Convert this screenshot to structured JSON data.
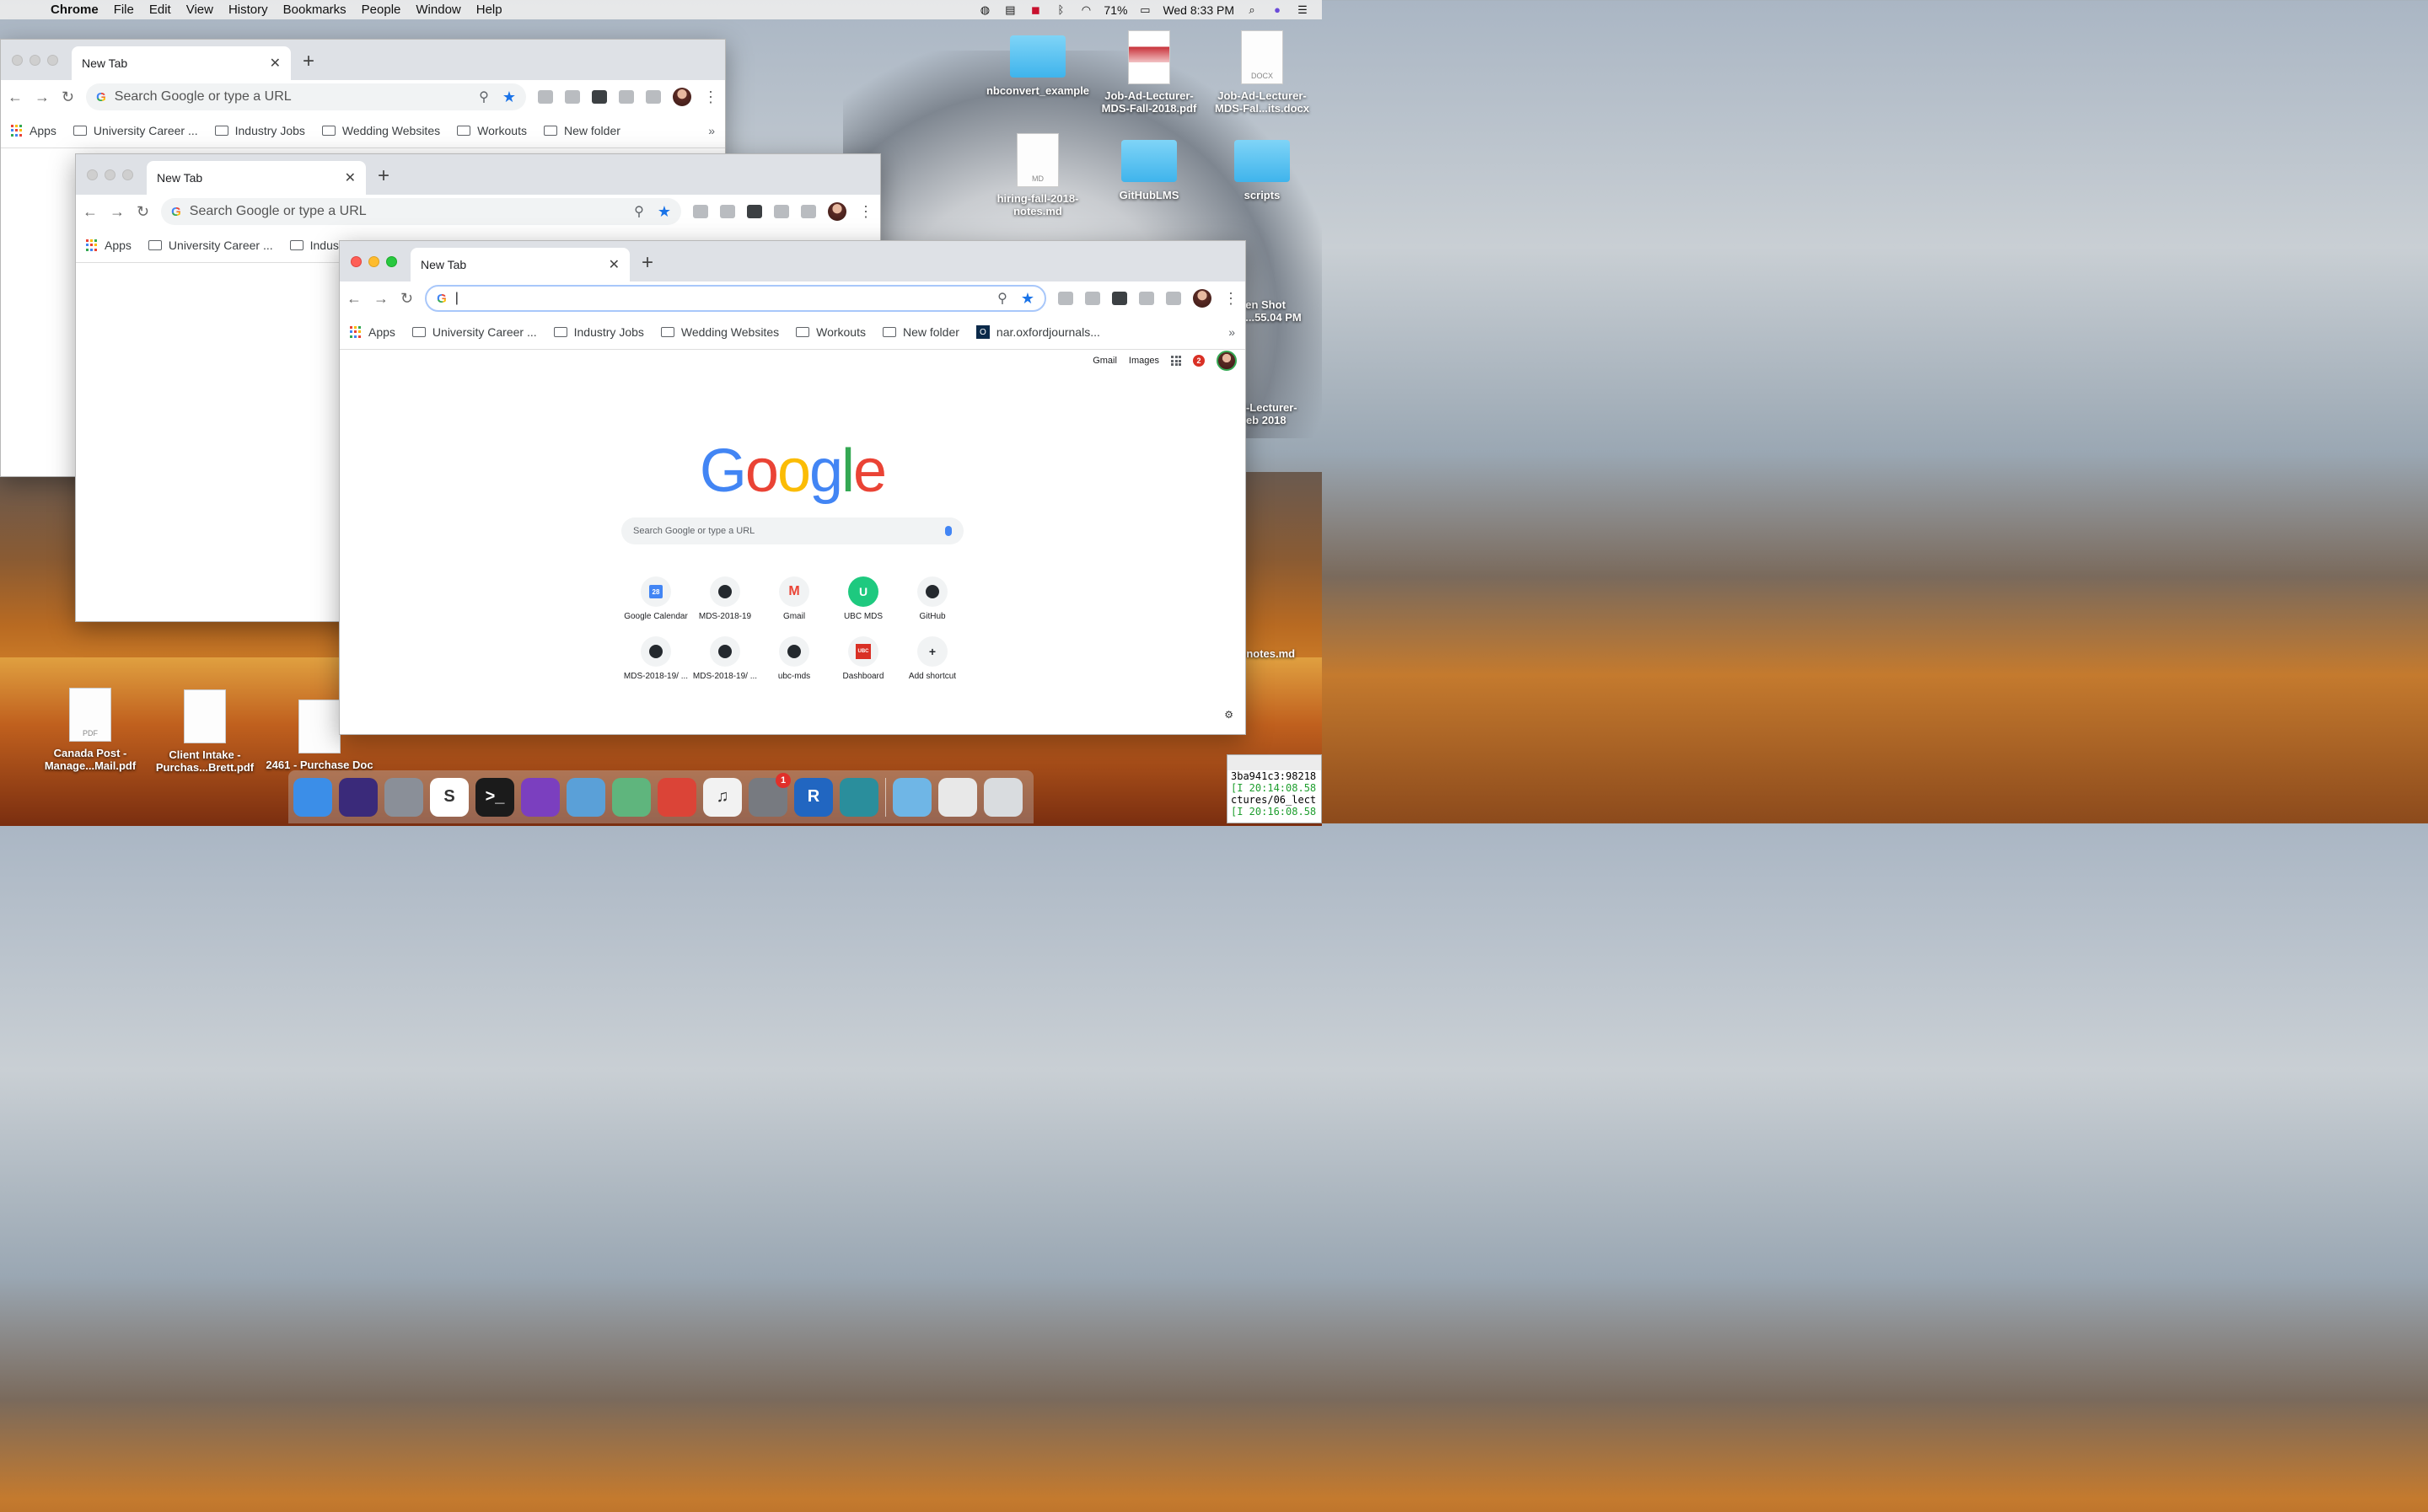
{
  "menubar": {
    "app": "Chrome",
    "items": [
      "File",
      "Edit",
      "View",
      "History",
      "Bookmarks",
      "People",
      "Window",
      "Help"
    ],
    "battery": "71%",
    "clock": "Wed 8:33 PM"
  },
  "browser": {
    "tab_title": "New Tab",
    "omnibox_placeholder": "Search Google or type a URL",
    "bookmarks": [
      {
        "label": "Apps"
      },
      {
        "label": "University Career ..."
      },
      {
        "label": "Industry Jobs"
      },
      {
        "label": "Wedding Websites"
      },
      {
        "label": "Workouts"
      },
      {
        "label": "New folder"
      },
      {
        "label": "nar.oxfordjournals..."
      }
    ],
    "more": "»"
  },
  "ntp": {
    "gmail": "Gmail",
    "images": "Images",
    "notifications": "2",
    "logo_letters": [
      "G",
      "o",
      "o",
      "g",
      "l",
      "e"
    ],
    "logo_colors": [
      "#4285f4",
      "#ea4335",
      "#fbbc05",
      "#4285f4",
      "#34a853",
      "#ea4335"
    ],
    "search_placeholder": "Search Google or type a URL",
    "shortcuts": [
      {
        "label": "Google Calendar",
        "icon": "calendar-icon",
        "glyph": "28"
      },
      {
        "label": "MDS-2018-19",
        "icon": "github-icon"
      },
      {
        "label": "Gmail",
        "icon": "gmail-icon",
        "glyph": "M"
      },
      {
        "label": "UBC MDS",
        "icon": "letter-u-icon",
        "glyph": "U"
      },
      {
        "label": "GitHub",
        "icon": "github-icon"
      },
      {
        "label": "MDS-2018-19/ ...",
        "icon": "github-icon"
      },
      {
        "label": "MDS-2018-19/ ...",
        "icon": "github-icon"
      },
      {
        "label": "ubc-mds",
        "icon": "github-icon"
      },
      {
        "label": "Dashboard",
        "icon": "ubc-icon",
        "glyph": "UBC"
      },
      {
        "label": "Add shortcut",
        "icon": "plus-icon",
        "glyph": "+"
      }
    ]
  },
  "desktop": {
    "icons": [
      {
        "label": "nbconvert_example",
        "kind": "folder"
      },
      {
        "label": "Job-Ad-Lecturer-MDS-Fall-2018.pdf",
        "kind": "doc"
      },
      {
        "label": "Job-Ad-Lecturer-MDS-Fal...its.docx",
        "kind": "doc",
        "tag": "DOCX"
      },
      {
        "label": "hiring-fall-2018-notes.md",
        "kind": "doc",
        "tag": "MD"
      },
      {
        "label": "GitHubLMS",
        "kind": "folder"
      },
      {
        "label": "scripts",
        "kind": "folder"
      },
      {
        "label": "Canada Post - Manage...Mail.pdf",
        "kind": "doc",
        "tag": "PDF"
      },
      {
        "label": "Client Intake - Purchas...Brett.pdf",
        "kind": "doc"
      },
      {
        "label": "2461 - Purchase Doc",
        "kind": "doc"
      }
    ],
    "partial_labels": [
      "een Shot",
      "1...55.04 PM",
      "d-Lecturer-",
      "Feb 2018",
      "-notes.md"
    ]
  },
  "dock": {
    "apps": [
      {
        "name": "finder-icon",
        "color": "#3b8ee8"
      },
      {
        "name": "siri-icon",
        "color": "#3a2a7a"
      },
      {
        "name": "launchpad-icon",
        "color": "#8a8f98"
      },
      {
        "name": "slack-icon",
        "color": "#ffffff",
        "glyph": "S"
      },
      {
        "name": "terminal-icon",
        "color": "#1b1b1b",
        "glyph": ">_"
      },
      {
        "name": "github-desktop-icon",
        "color": "#7b3fbf"
      },
      {
        "name": "preview-icon",
        "color": "#5aa0d8"
      },
      {
        "name": "atom-icon",
        "color": "#5fb57d"
      },
      {
        "name": "chrome-icon",
        "color": "#db4437"
      },
      {
        "name": "itunes-icon",
        "color": "#f2f2f2",
        "glyph": "♫"
      },
      {
        "name": "system-preferences-icon",
        "color": "#777a80",
        "badge": "1"
      },
      {
        "name": "r-icon",
        "color": "#2166c1",
        "glyph": "R"
      },
      {
        "name": "globe-icon",
        "color": "#2a8e9c"
      }
    ],
    "right_apps": [
      {
        "name": "downloads-icon",
        "color": "#6fb6e6"
      },
      {
        "name": "documents-icon",
        "color": "#e8e8e8"
      },
      {
        "name": "trash-icon",
        "color": "#d9dcdf"
      }
    ]
  },
  "terminal": {
    "lines": [
      "3ba941c3:98218",
      "[I 20:14:08.58",
      "ctures/06_lect",
      "[I 20:16:08.58"
    ]
  }
}
